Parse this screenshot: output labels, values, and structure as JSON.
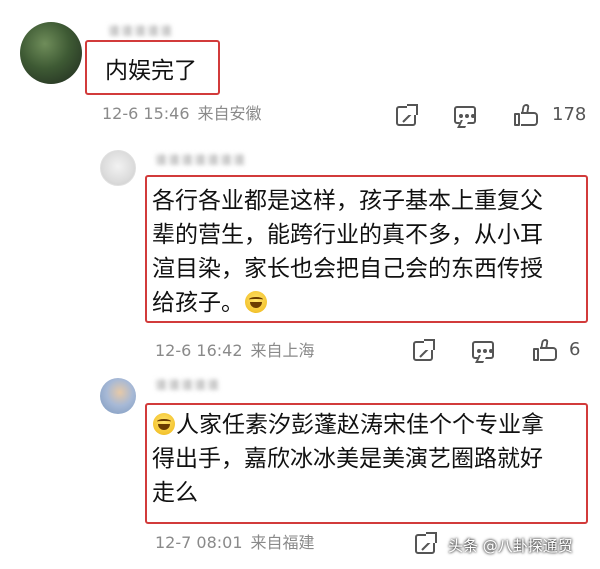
{
  "comments": [
    {
      "username": "谁谁谁谁谁",
      "text": "内娱完了",
      "date": "12-6 15:46",
      "location": "来自安徽",
      "like_count": "178",
      "icons": [
        "share-icon",
        "comment-icon",
        "like-icon"
      ]
    },
    {
      "username": "谁谁谁谁谁谁谁",
      "text_lines": [
        "各行各业都是这样，孩子基本上重复父",
        "辈的营生，能跨行业的真不多，从小耳",
        "渲目染，家长也会把自己会的东西传授",
        "给孩子。"
      ],
      "trailing_emoji": "laugh-cry-emoji",
      "date": "12-6 16:42",
      "location": "来自上海",
      "like_count": "6"
    },
    {
      "username": "谁谁谁谁谁",
      "leading_emoji": "laugh-cry-emoji",
      "text_lines": [
        "人家任素汐彭蓬赵涛宋佳个个专业拿",
        "得出手，嘉欣冰冰美是美演艺圈路就好",
        "走么"
      ],
      "date": "12-7 08:01",
      "location": "来自福建"
    }
  ],
  "watermark": "头条 @八卦探通贸",
  "colors": {
    "highlight_border": "#d23b3b",
    "meta_text": "#8a8a8a",
    "body_text": "#111111"
  }
}
